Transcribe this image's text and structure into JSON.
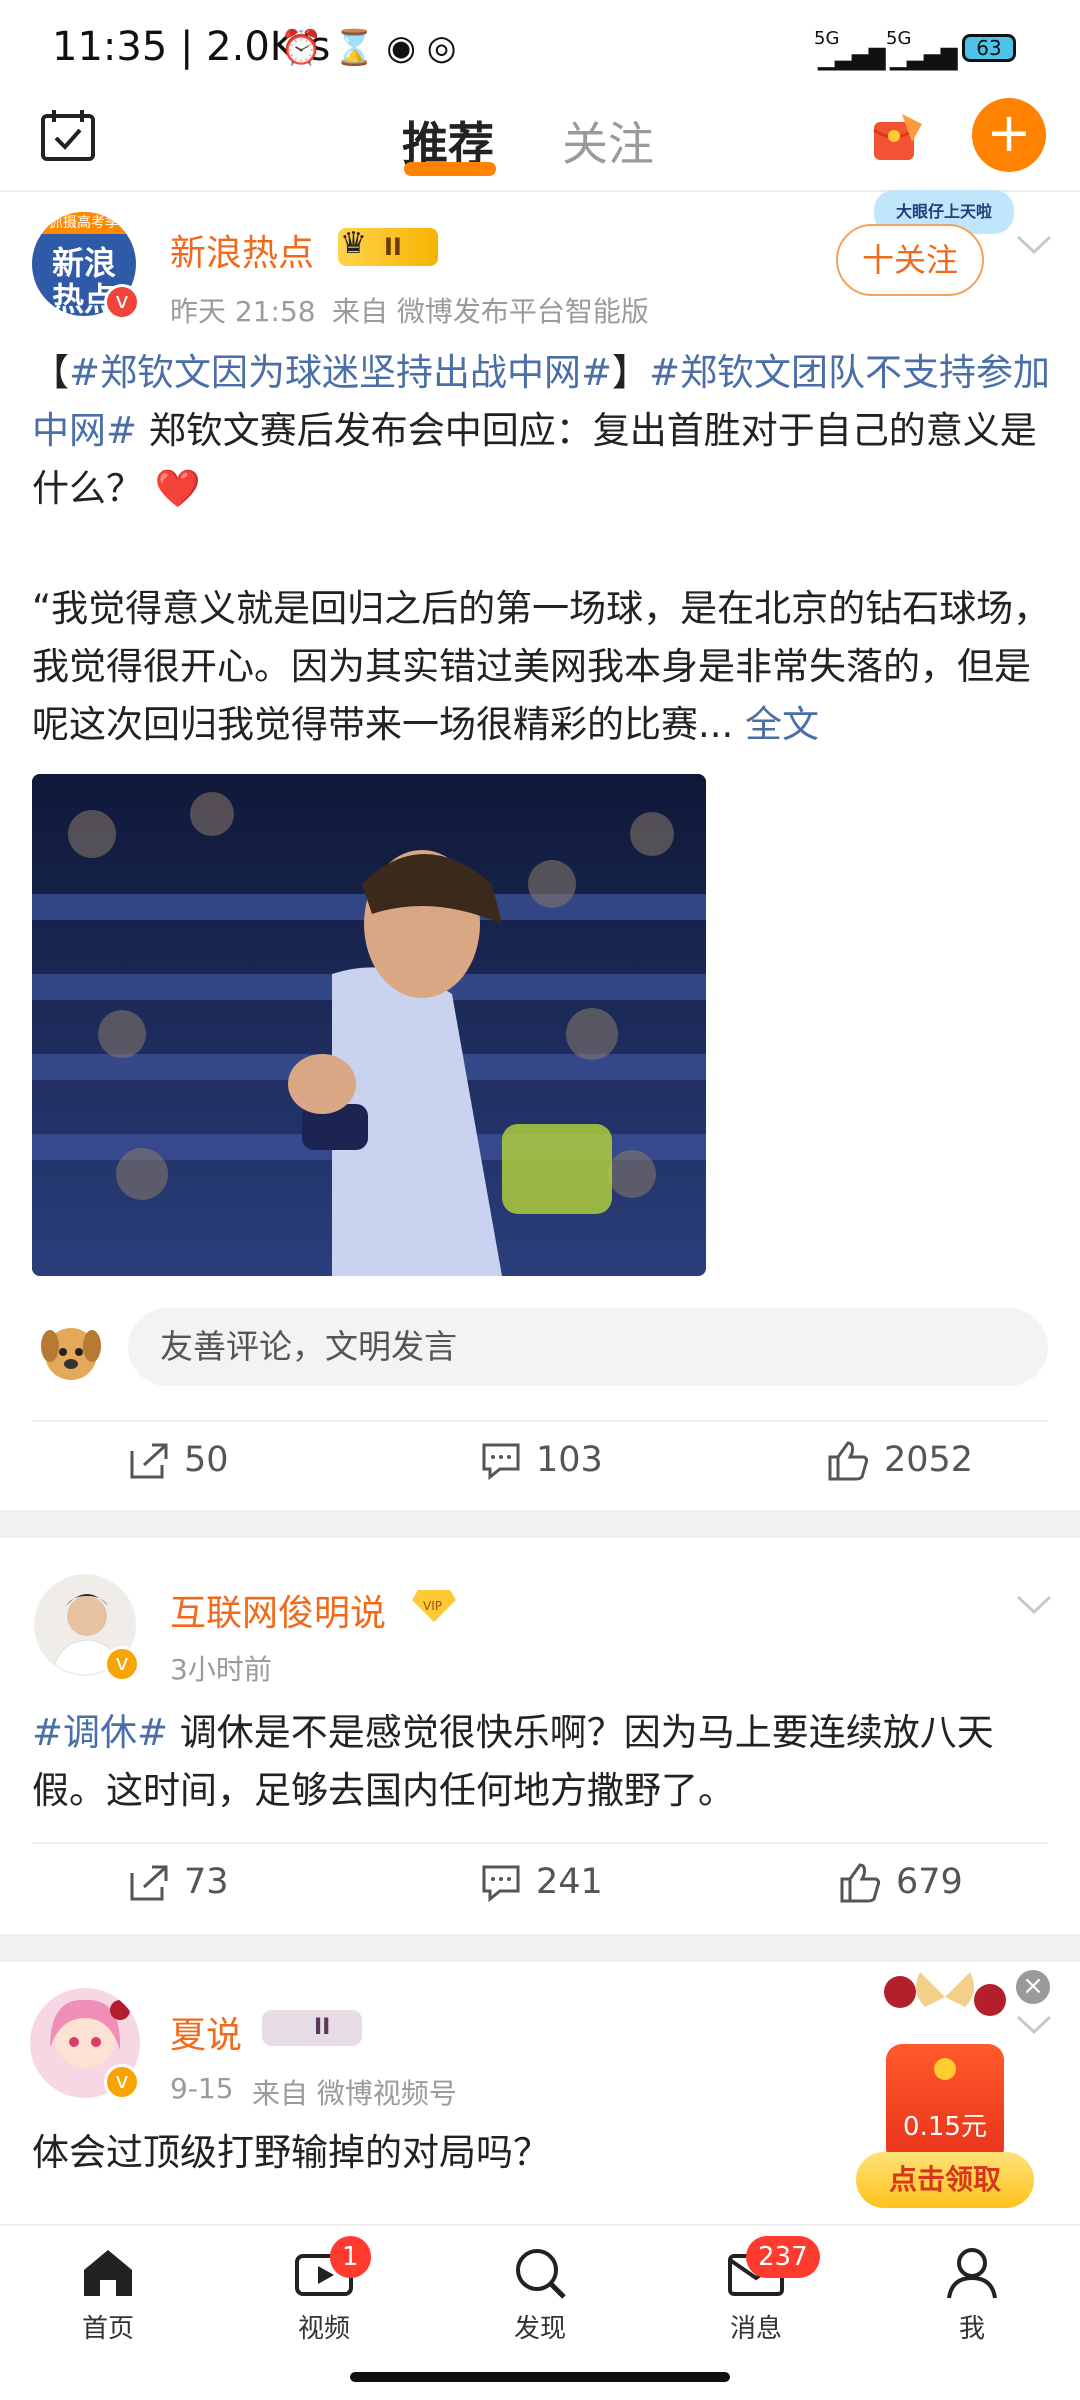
{
  "status_bar": {
    "time": "11:35 | 2.0K/s",
    "signal1": "5G",
    "signal2": "5G",
    "battery": "63"
  },
  "top_nav": {
    "tabs": [
      {
        "label": "推荐",
        "active": true
      },
      {
        "label": "关注",
        "active": false
      }
    ],
    "plus_label": "+"
  },
  "posts": [
    {
      "author": "新浪热点",
      "avatar_text_top": "新浪",
      "avatar_text_bottom": "热点",
      "avatar_banner": "抓摄高考季",
      "rank_badge": "II",
      "time": "昨天 21:58",
      "source": "来自 微博发布平台智能版",
      "follow_label": "十关注",
      "decoration_label": "大眼仔上天啦",
      "text_prefix": "【",
      "tag1": "#郑钦文因为球迷坚持出战中网#",
      "text_mid": "】",
      "tag2": "#郑钦文团队不支持参加中网#",
      "text_body": " 郑钦文赛后发布会中回应：复出首胜对于自己的意义是什么？",
      "emoji": "❤️",
      "quote": "“我觉得意义就是回归之后的第一场球，是在北京的钻石球场，我觉得很开心。因为其实错过美网我本身是非常失落的，但是呢这次回归我觉得带来一场很精彩的比赛... ",
      "more_label": "全文",
      "comment_placeholder": "友善评论，文明发言",
      "reposts": "50",
      "comments": "103",
      "likes": "2052"
    },
    {
      "author": "互联网俊明说",
      "badge": "VIP",
      "time": "3小时前",
      "tag": "#调休#",
      "text": "  调休是不是感觉很快乐啊？因为马上要连续放八天假。这时间，足够去国内任何地方撒野了。",
      "reposts": "73",
      "comments": "241",
      "likes": "679"
    },
    {
      "author": "夏说",
      "rank_badge": "II",
      "time": "9-15",
      "source": "来自 微博视频号",
      "text": "体会过顶级打野输掉的对局吗？"
    }
  ],
  "ad": {
    "amount": "0.15元",
    "cta": "点击领取",
    "close": "×"
  },
  "bottom_nav": [
    {
      "label": "首页",
      "icon": "home-icon"
    },
    {
      "label": "视频",
      "icon": "video-icon",
      "badge": "1"
    },
    {
      "label": "发现",
      "icon": "search-icon"
    },
    {
      "label": "消息",
      "icon": "message-icon",
      "badge": "237"
    },
    {
      "label": "我",
      "icon": "profile-icon"
    }
  ],
  "colors": {
    "brand_orange": "#ff8200",
    "name_orange": "#f06a1c",
    "link_blue": "#4a6ea8",
    "badge_red": "#ff3b30"
  }
}
